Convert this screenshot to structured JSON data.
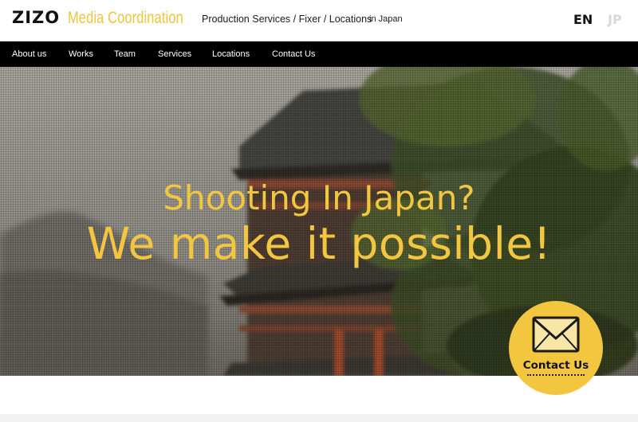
{
  "header": {
    "logo_mark": "ZIZO",
    "logo_sub": "Media Coordination",
    "tagline": "Production Services / Fixer / Locations",
    "tagline_sub": "in Japan",
    "lang_en": "EN",
    "lang_jp": "JP"
  },
  "nav": {
    "items": [
      {
        "label": "About us"
      },
      {
        "label": "Works"
      },
      {
        "label": "Team"
      },
      {
        "label": "Services"
      },
      {
        "label": "Locations"
      },
      {
        "label": "Contact Us"
      }
    ]
  },
  "hero": {
    "line1": "Shooting In Japan?",
    "line2": "We make it possible!"
  },
  "contact_fab": {
    "label": "Contact Us",
    "icon": "envelope-icon"
  },
  "colors": {
    "accent": "#f2c641",
    "nav_bg": "#000000",
    "lang_inactive": "#d8d8d8"
  }
}
